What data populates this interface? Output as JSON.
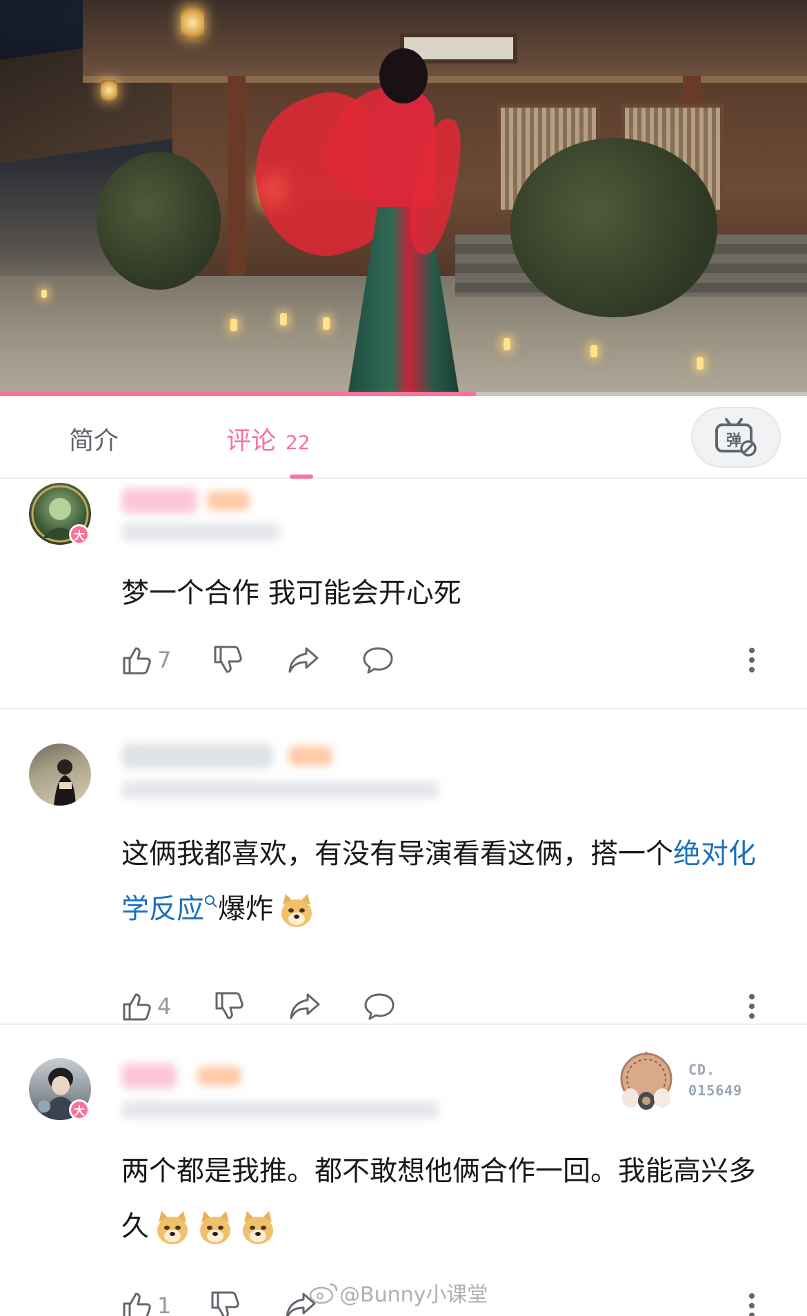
{
  "video": {
    "progress": 0.59
  },
  "tabs": {
    "intro_label": "简介",
    "comments_label": "评论",
    "comments_count": "22",
    "danmaku_label": "弹"
  },
  "comments": [
    {
      "text": "梦一个合作 我可能会开心死",
      "likes": "7",
      "badge": "大"
    },
    {
      "text_plain": "这俩我都喜欢，有没有导演看看这俩，搭一个",
      "text_link": "绝对化学反应",
      "text_after": "爆炸",
      "likes": "4"
    },
    {
      "text": "两个都是我推。都不敢想他俩合作一回。我能高兴多久",
      "likes": "1",
      "badge": "大",
      "medal_line1": "CD.",
      "medal_line2": "015649"
    }
  ],
  "watermark": "@Bunny小课堂",
  "colors": {
    "accent": "#fb7299",
    "link": "#1a6fbf",
    "icon": "#61666d"
  }
}
